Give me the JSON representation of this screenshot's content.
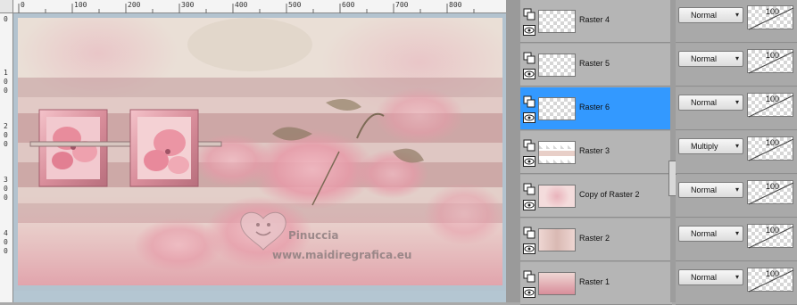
{
  "rulers": {
    "top_labels": [
      "0",
      "100",
      "200",
      "300",
      "400",
      "500",
      "600",
      "700",
      "800"
    ],
    "left_labels": [
      "0",
      "1\n0\n0",
      "2\n0\n0",
      "3\n0\n0",
      "4\n0\n0"
    ]
  },
  "watermark": {
    "line1": "Pinuccia",
    "line2": "www.maidiregrafica.eu"
  },
  "layers": [
    {
      "name": "Raster 4",
      "blend": "Normal",
      "opacity": "100",
      "selected": false
    },
    {
      "name": "Raster 5",
      "blend": "Normal",
      "opacity": "100",
      "selected": false
    },
    {
      "name": "Raster 6",
      "blend": "Normal",
      "opacity": "100",
      "selected": true
    },
    {
      "name": "Raster 3",
      "blend": "Multiply",
      "opacity": "100",
      "selected": false
    },
    {
      "name": "Copy of Raster 2",
      "blend": "Normal",
      "opacity": "100",
      "selected": false
    },
    {
      "name": "Raster 2",
      "blend": "Normal",
      "opacity": "100",
      "selected": false
    },
    {
      "name": "Raster 1",
      "blend": "Normal",
      "opacity": "100",
      "selected": false
    }
  ],
  "colors": {
    "selection": "#3399ff",
    "pink": "#e8a2ad",
    "rose": "#c97f8a"
  },
  "icons": {
    "group": "layer-group-icon",
    "visibility": "eye-icon",
    "dropdown": "chevron-down-icon"
  }
}
